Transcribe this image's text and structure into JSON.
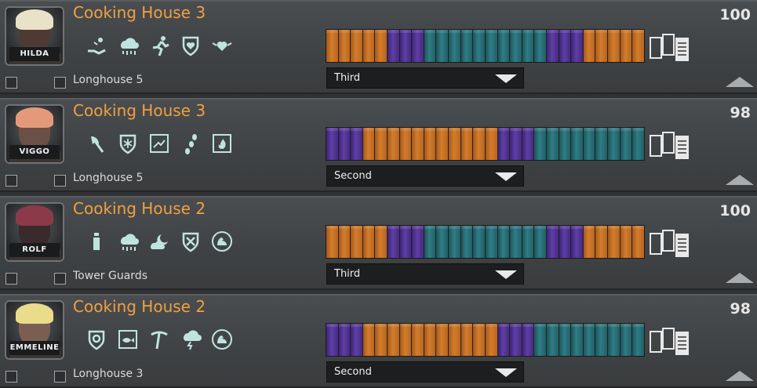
{
  "colors": {
    "title": "#f0a043",
    "work": "#d37d2b",
    "sleep": "#5f3fa6",
    "leisure": "#2f7d85"
  },
  "villagers": [
    {
      "name": "HILDA",
      "workplace_title": "Cooking House 3",
      "residence": "Longhouse 5",
      "happiness": "100",
      "shift": "Third",
      "traits": [
        "watering-hand-icon",
        "rain-cloud-icon",
        "running-figure-icon",
        "heart-shield-icon",
        "winged-heart-icon"
      ],
      "schedule": [
        "work",
        "work",
        "work",
        "work",
        "work",
        "sleep",
        "sleep",
        "sleep",
        "leisure",
        "leisure",
        "leisure",
        "leisure",
        "leisure",
        "leisure",
        "leisure",
        "leisure",
        "leisure",
        "leisure",
        "sleep",
        "sleep",
        "sleep",
        "work",
        "work",
        "work",
        "work",
        "work"
      ],
      "hair": "#e8e2c8",
      "skin": "#4d3a33"
    },
    {
      "name": "VIGGO",
      "workplace_title": "Cooking House 3",
      "residence": "Longhouse 5",
      "happiness": "98",
      "shift": "Second",
      "traits": [
        "axe-icon",
        "snowflake-shield-icon",
        "frame-splash-icon",
        "footprints-icon",
        "frame-fire-icon"
      ],
      "schedule": [
        "sleep",
        "sleep",
        "sleep",
        "work",
        "work",
        "work",
        "work",
        "work",
        "work",
        "work",
        "work",
        "work",
        "work",
        "work",
        "sleep",
        "sleep",
        "sleep",
        "leisure",
        "leisure",
        "leisure",
        "leisure",
        "leisure",
        "leisure",
        "leisure",
        "leisure",
        "leisure"
      ],
      "hair": "#e49a7a",
      "skin": "#6b5048"
    },
    {
      "name": "ROLF",
      "workplace_title": "Cooking House 2",
      "residence": "Tower Guards",
      "happiness": "100",
      "shift": "Third",
      "traits": [
        "bottle-icon",
        "rain-cloud-icon",
        "cloud-moon-icon",
        "crossed-tools-shield-icon",
        "muscle-arm-icon"
      ],
      "schedule": [
        "work",
        "work",
        "work",
        "work",
        "work",
        "sleep",
        "sleep",
        "sleep",
        "leisure",
        "leisure",
        "leisure",
        "leisure",
        "leisure",
        "leisure",
        "leisure",
        "leisure",
        "leisure",
        "leisure",
        "sleep",
        "sleep",
        "sleep",
        "work",
        "work",
        "work",
        "work",
        "work"
      ],
      "hair": "#8c3a4a",
      "skin": "#3a2a2c"
    },
    {
      "name": "EMMELINE",
      "workplace_title": "Cooking House 2",
      "residence": "Longhouse 3",
      "happiness": "98",
      "shift": "Second",
      "traits": [
        "gear-shield-icon",
        "frame-fish-icon",
        "pickaxe-icon",
        "storm-cloud-icon",
        "muscle-arm-icon"
      ],
      "schedule": [
        "sleep",
        "sleep",
        "sleep",
        "work",
        "work",
        "work",
        "work",
        "work",
        "work",
        "work",
        "work",
        "work",
        "work",
        "work",
        "sleep",
        "sleep",
        "sleep",
        "leisure",
        "leisure",
        "leisure",
        "leisure",
        "leisure",
        "leisure",
        "leisure",
        "leisure",
        "leisure"
      ],
      "hair": "#e9dc8a",
      "skin": "#7a5e52"
    }
  ]
}
